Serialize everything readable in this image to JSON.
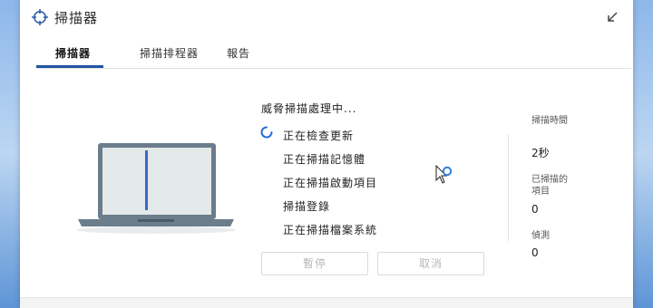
{
  "window": {
    "title": "掃描器",
    "collapse_icon": "arrow-collapse-icon",
    "app_icon": "crosshair-icon"
  },
  "tabs": [
    {
      "label": "掃描器",
      "active": true
    },
    {
      "label": "掃描排程器",
      "active": false
    },
    {
      "label": "報告",
      "active": false
    }
  ],
  "scan": {
    "status": "威脅掃描處理中...",
    "steps": [
      {
        "label": "正在檢查更新",
        "state": "in-progress"
      },
      {
        "label": "正在掃描記憶體",
        "state": "pending"
      },
      {
        "label": "正在掃描啟動項目",
        "state": "pending"
      },
      {
        "label": "掃描登錄",
        "state": "pending"
      },
      {
        "label": "正在掃描檔案系統",
        "state": "pending"
      }
    ],
    "pause_label": "暫停",
    "cancel_label": "取消"
  },
  "stats": {
    "time_label": "掃描時間",
    "time_value": "2秒",
    "scanned_label": "已掃描的項目",
    "scanned_value": "0",
    "detections_label": "偵測",
    "detections_value": "0"
  },
  "colors": {
    "accent": "#2055a4",
    "spinner": "#2a6fd6",
    "disabled_text": "#b8b8b8"
  }
}
